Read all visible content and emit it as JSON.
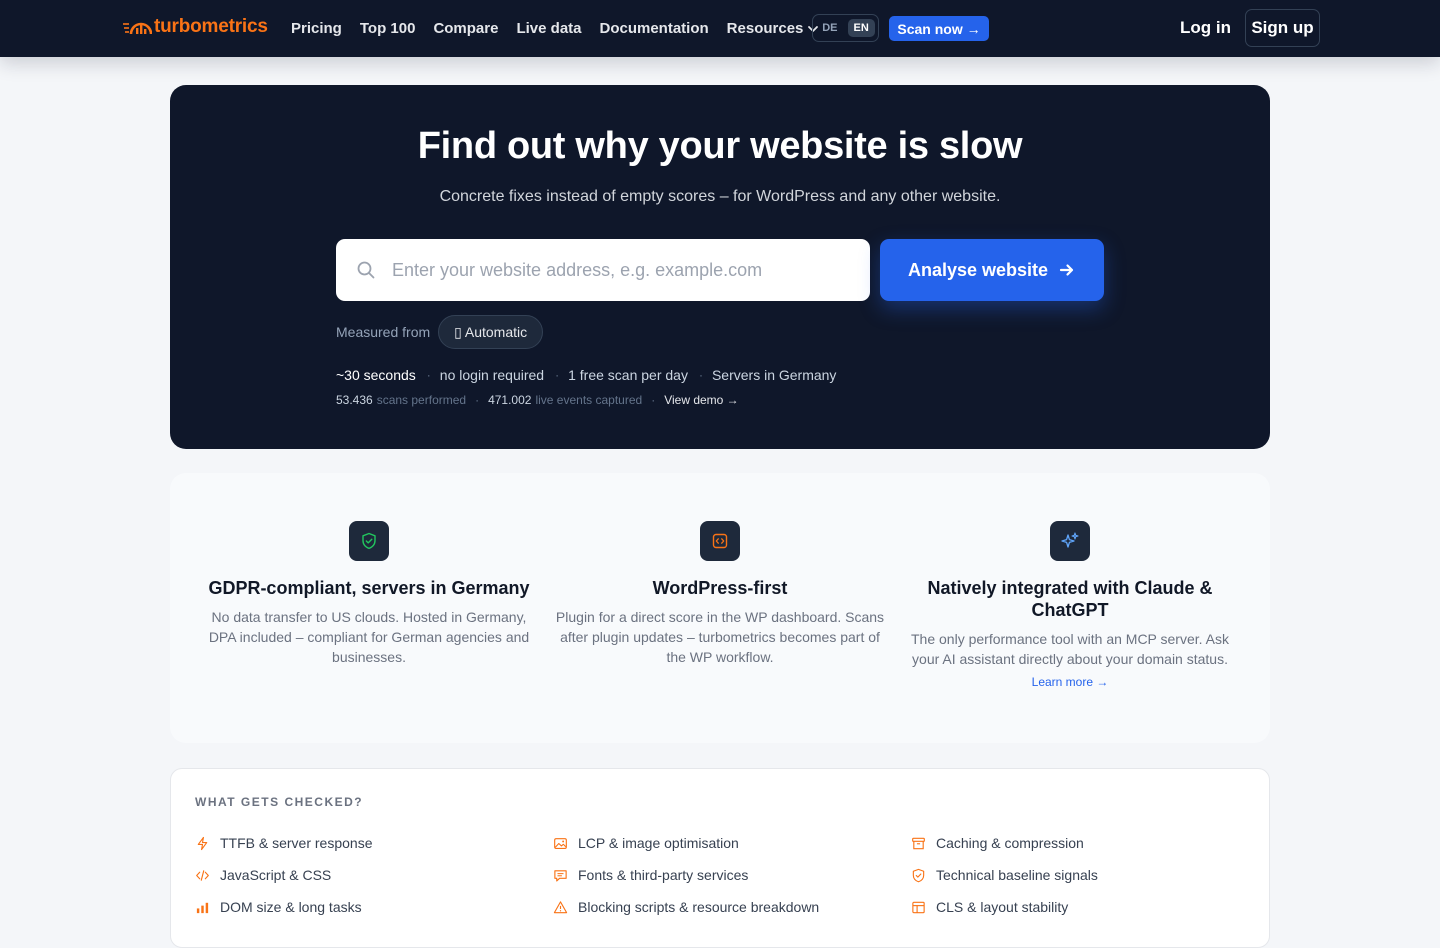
{
  "nav": {
    "brand": "turbometrics",
    "links": [
      "Pricing",
      "Top 100",
      "Compare",
      "Live data",
      "Documentation",
      "Resources"
    ],
    "lang": [
      "DE",
      "EN"
    ],
    "active_lang": "EN",
    "scan_now": "Scan now →",
    "login": "Log in",
    "signup": "Sign up"
  },
  "hero": {
    "title": "Find out why your website is slow",
    "subtitle": "Concrete fixes instead of empty scores – for WordPress and any other website.",
    "search_placeholder": "Enter your website address, e.g. example.com",
    "analyse_button": "Analyse website",
    "measured_label": "Measured from",
    "measured_value": "Automatic",
    "facts": [
      "~30 seconds",
      "no login required",
      "1 free scan per day",
      "Servers in Germany"
    ],
    "stats": [
      {
        "number": "53.436",
        "label": "scans performed"
      },
      {
        "number": "471.002",
        "label": "live events captured"
      }
    ],
    "demo_link": "View demo →"
  },
  "features": [
    {
      "icon": "shield-check-icon",
      "title": "GDPR-compliant, servers in Germany",
      "text": "No data transfer to US clouds. Hosted in Germany, DPA included – compliant for German agencies and businesses.",
      "link": ""
    },
    {
      "icon": "code-icon",
      "title": "WordPress-first",
      "text": "Plugin for a direct score in the WP dashboard. Scans after plugin updates – turbometrics becomes part of the WP workflow.",
      "link": ""
    },
    {
      "icon": "sparkles-icon",
      "title": "Natively integrated with Claude & ChatGPT",
      "text": "The only performance tool with an MCP server. Ask your AI assistant directly about your domain status.",
      "link": "Learn more →"
    }
  ],
  "checks": {
    "title": "WHAT GETS CHECKED?",
    "columns": [
      [
        {
          "icon": "bolt-icon",
          "label": "TTFB & server response"
        },
        {
          "icon": "code-icon",
          "label": "JavaScript & CSS"
        },
        {
          "icon": "bar-chart-icon",
          "label": "DOM size & long tasks"
        }
      ],
      [
        {
          "icon": "image-icon",
          "label": "LCP & image optimisation"
        },
        {
          "icon": "chat-icon",
          "label": "Fonts & third-party services"
        },
        {
          "icon": "warning-icon",
          "label": "Blocking scripts & resource breakdown"
        }
      ],
      [
        {
          "icon": "archive-icon",
          "label": "Caching & compression"
        },
        {
          "icon": "shield-icon",
          "label": "Technical baseline signals"
        },
        {
          "icon": "layout-icon",
          "label": "CLS & layout stability"
        }
      ]
    ]
  },
  "colors": {
    "brand_orange": "#f97316",
    "primary_blue": "#2563eb",
    "navy": "#0f172a",
    "feature_green": "#22c55e",
    "feature_orange": "#f97316",
    "feature_blue": "#60a5fa"
  }
}
